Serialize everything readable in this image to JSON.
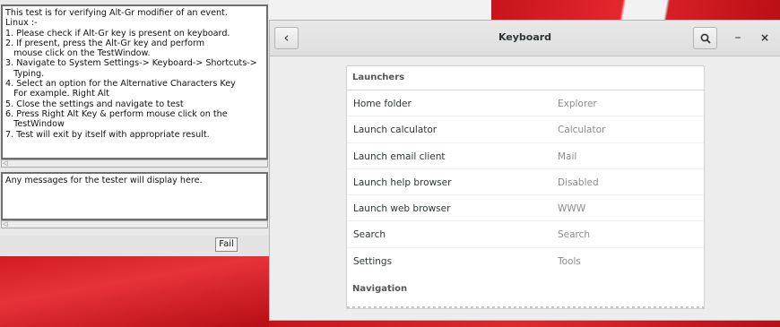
{
  "instructions": {
    "text": "This test is for verifying Alt-Gr modifier of an event.\nLinux :-\n1. Please check if Alt-Gr key is present on keyboard.\n2. If present, press the Alt-Gr key and perform\n   mouse click on the TestWindow.\n3. Navigate to System Settings-> Keyboard-> Shortcuts->\n   Typing.\n4. Select an option for the Alternative Characters Key\n   For example. Right Alt\n5. Close the settings and navigate to test\n6. Press Right Alt Key & perform mouse click on the\n   TestWindow\n7. Test will exit by itself with appropriate result.",
    "messages": "Any messages for the tester will display here.",
    "fail_label": "Fail"
  },
  "keyboard_window": {
    "title": "Keyboard",
    "back_icon": "chevron-left-icon",
    "search_icon": "search-icon",
    "minimize_label": "–",
    "close_label": "×",
    "section_launchers": "Launchers",
    "section_navigation": "Navigation",
    "launchers": [
      {
        "name": "Home folder",
        "accel": "Explorer"
      },
      {
        "name": "Launch calculator",
        "accel": "Calculator"
      },
      {
        "name": "Launch email client",
        "accel": "Mail"
      },
      {
        "name": "Launch help browser",
        "accel": "Disabled"
      },
      {
        "name": "Launch web browser",
        "accel": "WWW"
      },
      {
        "name": "Search",
        "accel": "Search"
      },
      {
        "name": "Settings",
        "accel": "Tools"
      }
    ]
  },
  "colors": {
    "desktop_red": "#d21b22",
    "header_text": "#2e3436",
    "accel_text": "#8a8a8a"
  }
}
